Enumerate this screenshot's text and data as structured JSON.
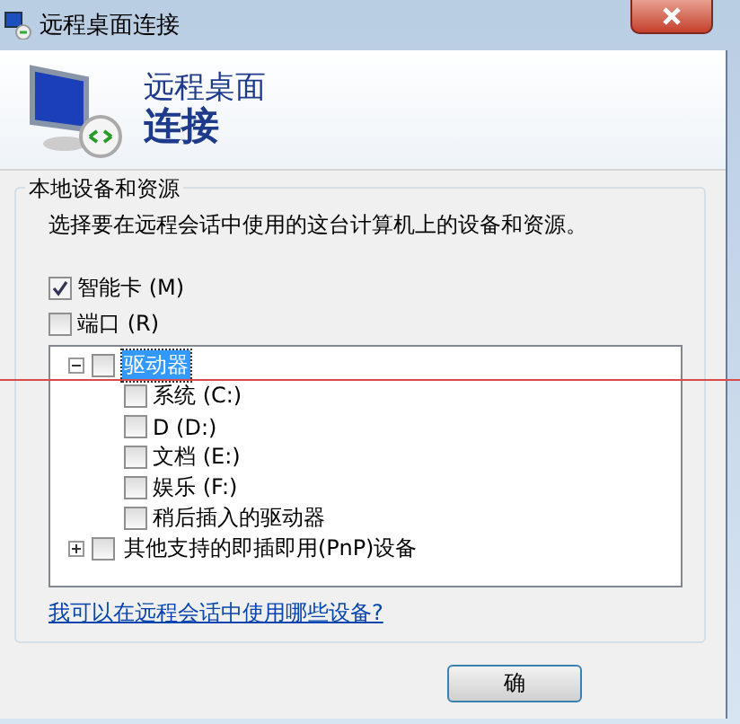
{
  "window": {
    "title": "远程桌面连接"
  },
  "header": {
    "line1": "远程桌面",
    "line2": "连接"
  },
  "group": {
    "title": "本地设备和资源",
    "description": "选择要在远程会话中使用的这台计算机上的设备和资源。",
    "options": [
      {
        "label": "智能卡 (M)",
        "checked": true
      },
      {
        "label": "端口 (R)",
        "checked": false
      }
    ],
    "tree": [
      {
        "label": "驱动器",
        "checked": false,
        "expanded": true,
        "selected": true,
        "children": [
          {
            "label": "系统 (C:)",
            "checked": false
          },
          {
            "label": "D (D:)",
            "checked": false
          },
          {
            "label": "文档 (E:)",
            "checked": false
          },
          {
            "label": "娱乐 (F:)",
            "checked": false
          },
          {
            "label": "稍后插入的驱动器",
            "checked": false
          }
        ]
      },
      {
        "label": "其他支持的即插即用(PnP)设备",
        "checked": false,
        "expanded": false,
        "selected": false
      }
    ],
    "link": "我可以在远程会话中使用哪些设备?"
  },
  "buttons": [
    "确"
  ]
}
